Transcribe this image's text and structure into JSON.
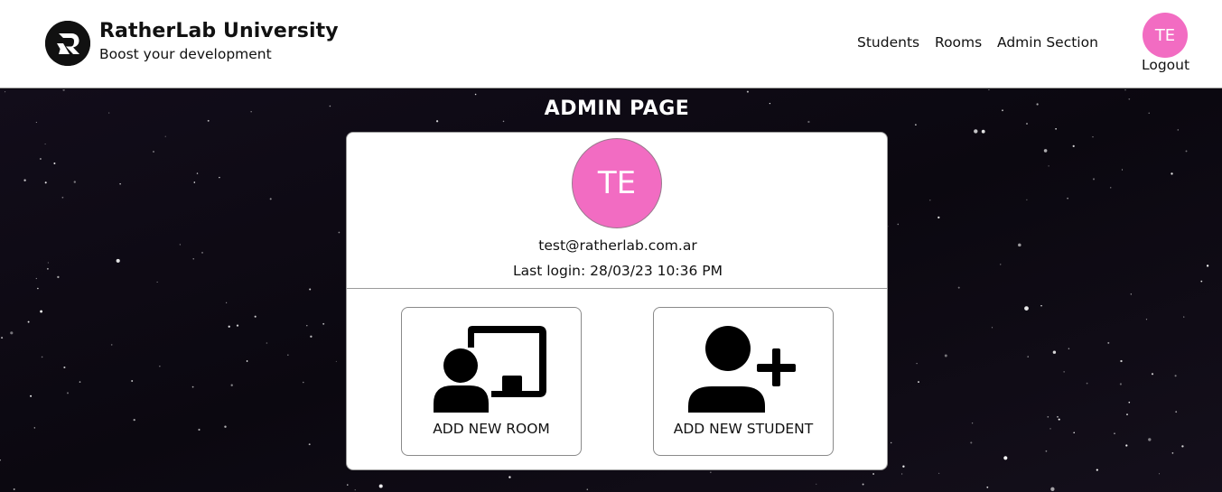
{
  "header": {
    "brand_title": "RatherLab University",
    "brand_subtitle": "Boost your development",
    "logo_icon": "ratherlab-logo-icon",
    "nav": [
      {
        "label": "Students"
      },
      {
        "label": "Rooms"
      },
      {
        "label": "Admin Section"
      }
    ],
    "user_initials": "TE",
    "logout_label": "Logout"
  },
  "main": {
    "title": "ADMIN PAGE",
    "profile": {
      "initials": "TE",
      "email": "test@ratherlab.com.ar",
      "last_login": "Last login: 28/03/23 10:36 PM"
    },
    "actions": [
      {
        "label": "ADD NEW ROOM",
        "icon": "chalkboard-user-icon"
      },
      {
        "label": "ADD NEW STUDENT",
        "icon": "user-plus-icon"
      }
    ]
  },
  "colors": {
    "avatar": "#f26cc2",
    "background": "#0b0810",
    "header_bg": "#ffffff",
    "card_bg": "#ffffff"
  }
}
